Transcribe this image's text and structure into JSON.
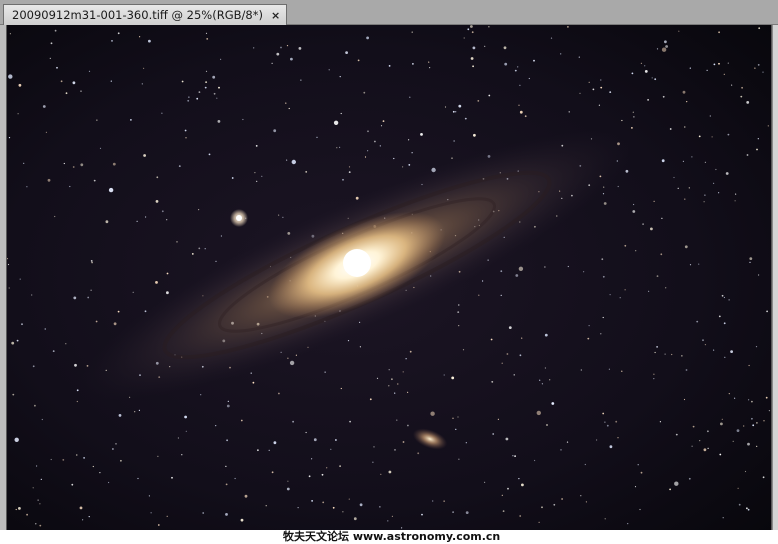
{
  "document_tab": {
    "title": "20090912m31-001-360.tiff @ 25%(RGB/8*)",
    "close_glyph": "×"
  },
  "image": {
    "subject": "Andromeda galaxy (M31) with companion M110 and M32, dense star field",
    "watermark": "牧夫天文论坛 www.astronomy.com.cn"
  },
  "colors": {
    "tab_bg": "#dcdcdc",
    "chrome_bg": "#bdbdbd",
    "sky": "#0d0a14",
    "galaxy_core": "#fff4d8",
    "galaxy_halo": "#b89870"
  }
}
